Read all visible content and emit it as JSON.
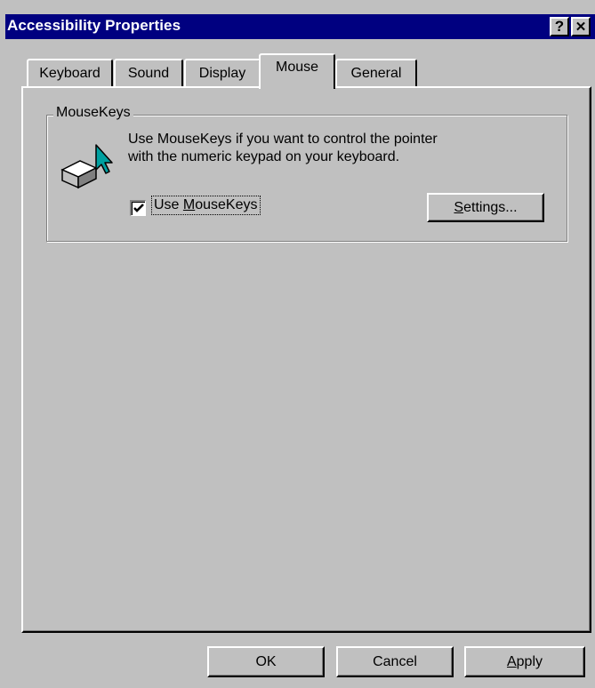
{
  "window": {
    "title": "Accessibility Properties",
    "help_glyph": "?",
    "close_glyph": "✕"
  },
  "tabs": [
    {
      "label": "Keyboard",
      "active": false
    },
    {
      "label": "Sound",
      "active": false
    },
    {
      "label": "Display",
      "active": false
    },
    {
      "label": "Mouse",
      "active": true
    },
    {
      "label": "General",
      "active": false
    }
  ],
  "mousekeys": {
    "group_label": "MouseKeys",
    "description_line1": "Use MouseKeys if you want to control the pointer",
    "description_line2": "with the numeric keypad on your keyboard.",
    "checkbox_checked": true,
    "checkbox_label_prefix": "Use ",
    "checkbox_label_accel": "M",
    "checkbox_label_rest": "ouseKeys",
    "settings_accel": "S",
    "settings_rest": "ettings..."
  },
  "footer": {
    "ok_label": "OK",
    "cancel_label": "Cancel",
    "apply_accel": "A",
    "apply_rest": "pply"
  },
  "colors": {
    "titlebar": "#000080",
    "face": "#c0c0c0",
    "pointer_accent": "#008080"
  },
  "icons": {
    "mousekeys": "keycap-with-arrow-pointer-icon",
    "check": "checkmark-icon"
  }
}
